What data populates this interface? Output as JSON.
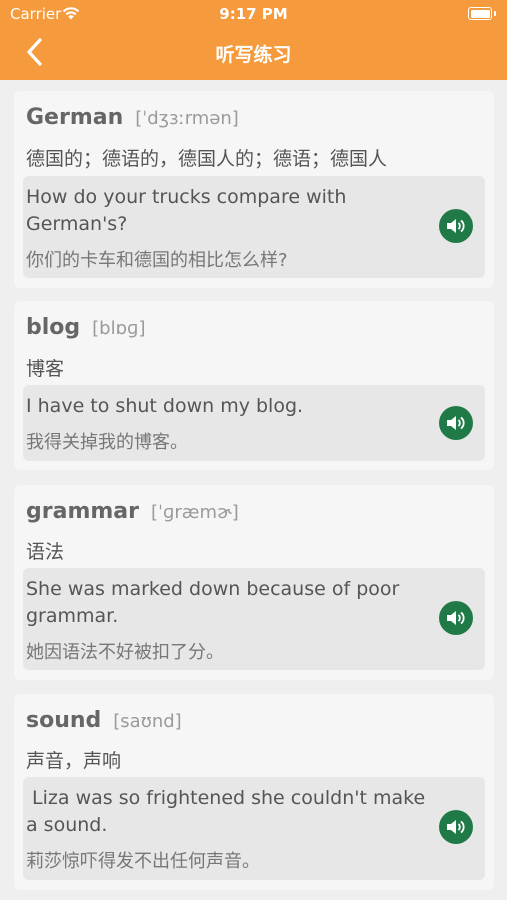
{
  "status_bar": {
    "carrier": "Carrier",
    "time": "9:17 PM"
  },
  "nav": {
    "title": "听写练习",
    "back_icon": "chevron-left-icon"
  },
  "colors": {
    "nav_bg": "#f59b3d",
    "speaker_bg": "#1f7a47"
  },
  "words": [
    {
      "word": "German",
      "phonetic": "[ˈdʒɜːrmən]",
      "meaning": "德国的；德语的，德国人的；德语；德国人",
      "example_en": "How do your trucks compare with German's?",
      "example_zh": "你们的卡车和德国的相比怎么样?"
    },
    {
      "word": "blog",
      "phonetic": "[blɒɡ]",
      "meaning": "博客",
      "example_en": "I have to shut down my blog.",
      "example_zh": "我得关掉我的博客。"
    },
    {
      "word": "grammar",
      "phonetic": "[ˈɡræmɚ]",
      "meaning": "语法",
      "example_en": "She was marked down because of poor grammar.",
      "example_zh": "她因语法不好被扣了分。"
    },
    {
      "word": "sound",
      "phonetic": "[saʊnd]",
      "meaning": "声音，声响",
      "example_en": " Liza was so frightened she couldn't make a sound.",
      "example_zh": "莉莎惊吓得发不出任何声音。"
    }
  ]
}
